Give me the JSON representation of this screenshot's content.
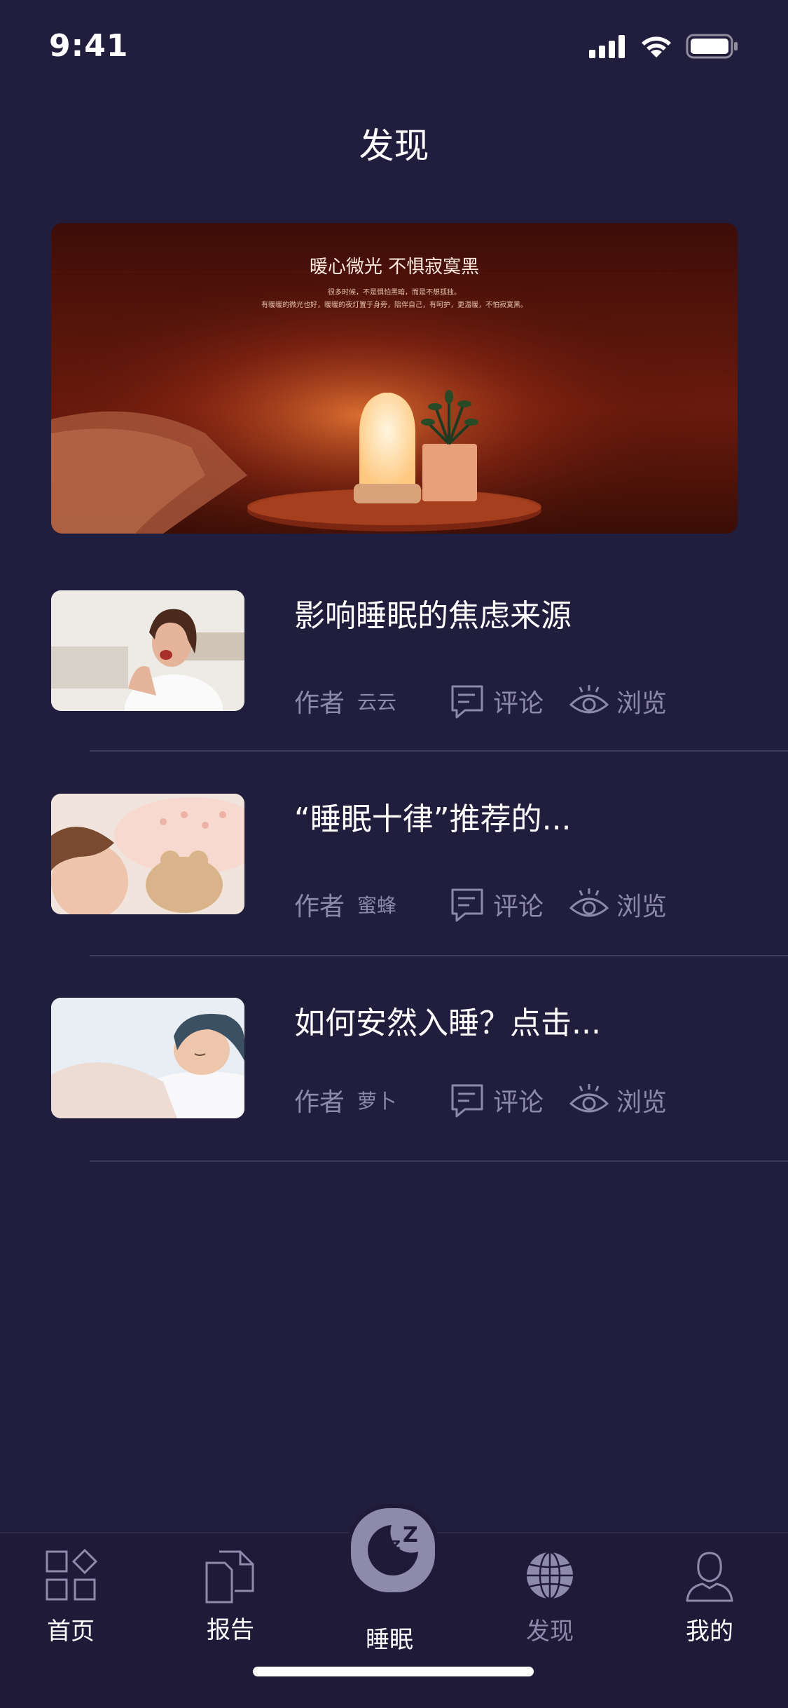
{
  "status_bar": {
    "time": "9:41"
  },
  "header": {
    "title": "发现"
  },
  "banner": {
    "headline": "暖心微光 不惧寂寞黑",
    "line1": "很多时候，不是惧怕黑暗，而是不想孤独。",
    "line2": "有暖暖的微光也好，暖暖的夜灯置于身旁，陪伴自己，有呵护，更温暖，不怕寂寞黑。"
  },
  "articles": [
    {
      "title": "影响睡眠的焦虑来源",
      "author_label": "作者",
      "author": "云云",
      "comment_label": "评论",
      "view_label": "浏览"
    },
    {
      "title": "“睡眠十律”推荐的...",
      "author_label": "作者",
      "author": "蜜蜂",
      "comment_label": "评论",
      "view_label": "浏览"
    },
    {
      "title": "如何安然入睡？点击...",
      "author_label": "作者",
      "author": "萝卜",
      "comment_label": "评论",
      "view_label": "浏览"
    }
  ],
  "tab_bar": {
    "tabs": [
      {
        "label": "首页",
        "icon": "grid-icon"
      },
      {
        "label": "报告",
        "icon": "documents-icon"
      },
      {
        "label": "睡眠",
        "icon": "moon-zz-icon"
      },
      {
        "label": "发现",
        "icon": "globe-icon"
      },
      {
        "label": "我的",
        "icon": "user-icon"
      }
    ]
  },
  "colors": {
    "background": "#211d3d",
    "muted_text": "#8d89ab",
    "tab_icon": "#8e8aab"
  }
}
